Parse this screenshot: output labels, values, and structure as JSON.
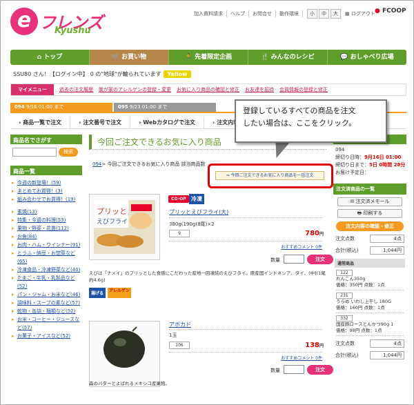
{
  "header": {
    "logo_main": "フレンズ",
    "logo_sub": "Kyushu",
    "links": [
      "加入資料請求",
      "ヘルプ",
      "お問合せ",
      "動作環境"
    ],
    "font_sizes": [
      "小",
      "中",
      "大"
    ],
    "logout": "ログアウト",
    "brand": "FCOOP"
  },
  "nav": {
    "items": [
      "トップ",
      "お買い物",
      "先着限定企画",
      "みんなのレシピ",
      "おしゃべり広場"
    ]
  },
  "greeting": {
    "user": "SSU80 さん！【ログイン中】",
    "points": "0 の\"地球\"が輪られています",
    "badge": "Yellow"
  },
  "mymenu": {
    "label": "マイメニュー",
    "links": [
      "過去の注文履歴",
      "我が家のアレルゲンの登録・変更",
      "お気に入り商品の確認と修正",
      "お友達を招待",
      "会員情報の登録と修正"
    ]
  },
  "order_tabs": [
    {
      "num": "094",
      "text": "9/16 01:00 まで"
    },
    {
      "num": "095",
      "text": "9/23 01:00 まで"
    }
  ],
  "cat_tabs": [
    "商品一覧で注文",
    "注文番号で注文",
    "Webカタログで注文",
    "注文内容の"
  ],
  "callout": {
    "line1": "登録しているすべての商品を注文",
    "line2": "したい場合は、ここをクリック。"
  },
  "left": {
    "search_head": "商品名でさがす",
    "search_btn": "検索",
    "list_head": "商品一覧",
    "specials": [
      "今週の新登場！(59)",
      "まとめてお買得！(3)",
      "組み合わせでお買得！(19)"
    ],
    "categories": [
      "素焼(13)",
      "特集・今週の料理(53)",
      "果物・野菜・花苗(112)",
      "お魚(84)",
      "お肉・ハム・ウインナー(91)",
      "とうふ・納豆・お惣菜など(65)",
      "冷凍食品・冷凍野菜など(40)",
      "たまご・牛乳・乳製品など(52)",
      "パン・ジャム・お米など(46)",
      "調味料・スープの素など(57)",
      "乾物・缶詰・麺類など(52)",
      "お米・コーヒー・ジュースなど(57)",
      "お菓子・アイスなど(52)"
    ]
  },
  "main": {
    "title": "今回ご注文できるお気に入り商品",
    "crumb_link": "094",
    "crumb_text": "> 今回ご注文できるお気に入り商品 該当商品数 ",
    "bulk_button": "今回ご注文できるお気に入り商品を一括注文",
    "qty_label": "数量",
    "order_btn": "注文",
    "comment": "おすすめコメント",
    "products": [
      {
        "coop": "CO-OP",
        "cold": "冷凍",
        "name": "プリッとえびフライ(大)",
        "spec": "380g(190g(8尾)×2",
        "code": "9",
        "price": "780",
        "yen": "円",
        "comments": "0件",
        "desc": "えびは「ナメイ」のプリッとした食感にこだわった産地一回凍結のえびフライ。原産国インドネシア、タイ、(中)(1尾約4.6g)",
        "tags": [
          "揚げる",
          "アレルゲン"
        ]
      },
      {
        "name": "アボカド",
        "spec": "1玉",
        "code": "106",
        "price": "138",
        "yen": "円",
        "comments": "0件",
        "desc": "森のバターとよばれるメキシコ産果物。"
      }
    ]
  },
  "right": {
    "num": "094",
    "deadline_label": "締切り日時：",
    "deadline": "9月16日 01:00",
    "remain_label": "締切り日まで：",
    "remain": "5日 0時間 28分",
    "delivery": "お届け予定日：",
    "list_head": "注文済商品の一覧",
    "memo_btn": "注文済メモール",
    "print_btn": "印刷する",
    "confirm_btn": "注文内容の確認・修正",
    "count_label": "注文点数",
    "count": "4点",
    "total_label": "合計(税込)",
    "total": "1,044円",
    "cart_head": "通常商品",
    "cart_items": [
      {
        "code": "122",
        "name": "れんこん350g",
        "price": "価格：350円 点数：1点"
      },
      {
        "code": "231",
        "name": "うらめ いわし上干し 180G",
        "price": "価格：160円 点数：1点"
      },
      {
        "code": "332",
        "name": "国産豚ロースとんかつ90g 1",
        "price": "価格：98円 点数：1点"
      }
    ]
  }
}
